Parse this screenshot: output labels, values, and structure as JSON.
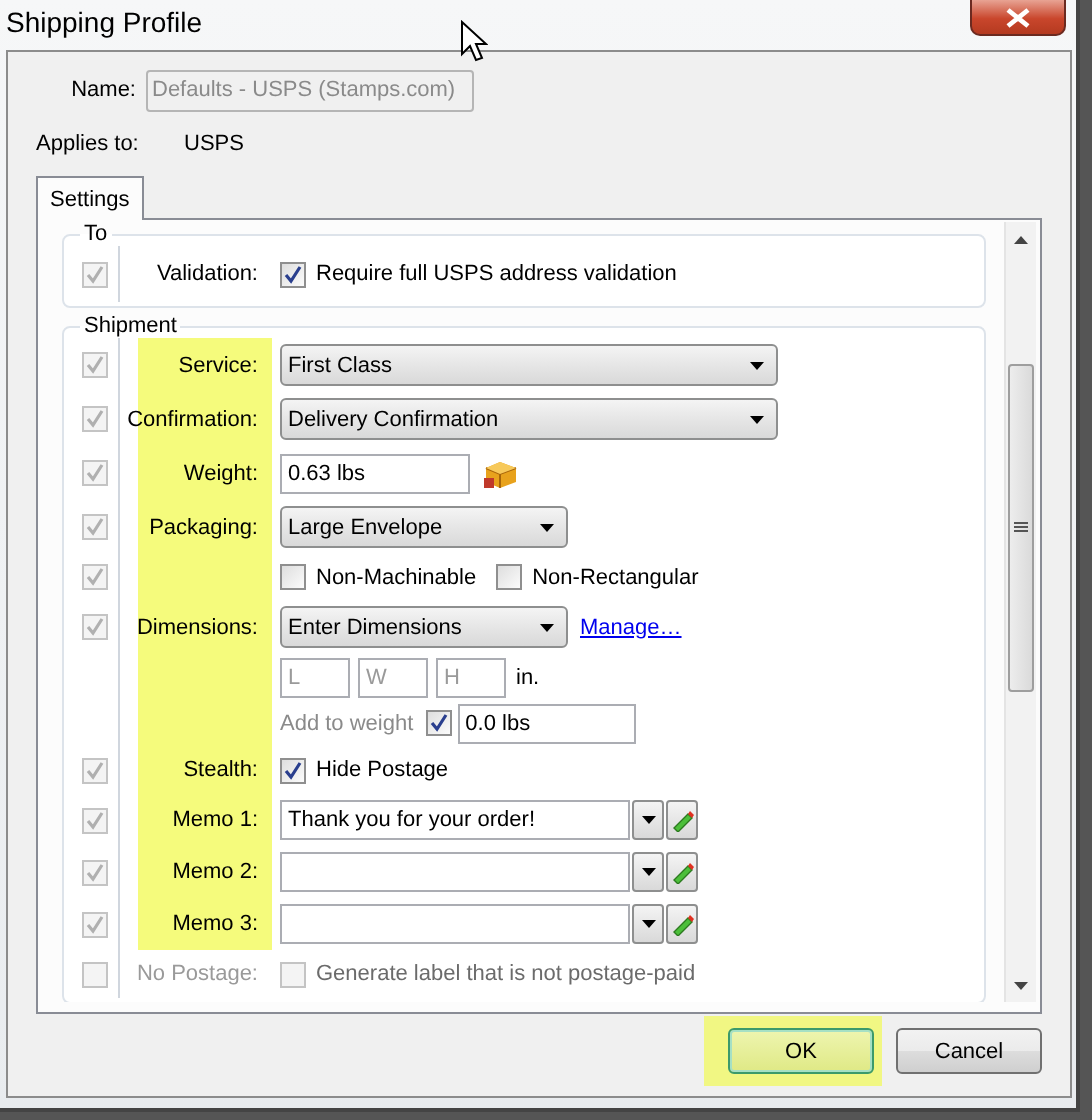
{
  "window": {
    "title": "Shipping Profile"
  },
  "name": {
    "label": "Name:",
    "value": "Defaults - USPS (Stamps.com)",
    "disabled": true
  },
  "applies_to": {
    "label": "Applies to:",
    "value": "USPS"
  },
  "tabs": [
    {
      "label": "Settings",
      "selected": true
    }
  ],
  "groups": [
    {
      "title": "To",
      "rows": [
        {
          "kind": "checkbox",
          "toggle": true,
          "highlighted": false,
          "disabled": false,
          "label": "Validation:",
          "option": {
            "label": "Require full USPS address validation",
            "checked": true
          }
        }
      ]
    },
    {
      "title": "Shipment",
      "rows": [
        {
          "kind": "dropdown",
          "toggle": true,
          "highlighted": true,
          "label": "Service:",
          "value": "First Class"
        },
        {
          "kind": "dropdown",
          "toggle": true,
          "highlighted": true,
          "label": "Confirmation:",
          "value": "Delivery Confirmation"
        },
        {
          "kind": "weight",
          "toggle": true,
          "highlighted": true,
          "label": "Weight:",
          "value": "0.63 lbs"
        },
        {
          "kind": "small_dropdown",
          "toggle": true,
          "highlighted": true,
          "label": "Packaging:",
          "value": "Large Envelope"
        },
        {
          "kind": "checkboxes",
          "toggle": true,
          "highlighted": true,
          "options": [
            {
              "label": "Non-Machinable",
              "checked": false
            },
            {
              "label": "Non-Rectangular",
              "checked": false
            }
          ]
        },
        {
          "kind": "small_dropdown",
          "toggle": true,
          "highlighted": true,
          "label": "Dimensions:",
          "value": "Enter Dimensions",
          "link": "Manage…"
        },
        {
          "kind": "dimensions",
          "highlighted": true,
          "placeholders": [
            "L",
            "W",
            "H"
          ],
          "unit": "in."
        },
        {
          "kind": "add_weight",
          "highlighted": true,
          "text": "Add to weight",
          "checked": true,
          "value": "0.0 lbs"
        },
        {
          "kind": "checkbox",
          "toggle": true,
          "highlighted": true,
          "disabled": false,
          "label": "Stealth:",
          "option": {
            "label": "Hide Postage",
            "checked": true
          }
        },
        {
          "kind": "memo",
          "toggle": true,
          "highlighted": true,
          "label": "Memo 1:",
          "value": "Thank you for your order!"
        },
        {
          "kind": "memo",
          "toggle": true,
          "highlighted": true,
          "label": "Memo 2:"
        },
        {
          "kind": "memo",
          "toggle": true,
          "highlighted": true,
          "label": "Memo 3:"
        },
        {
          "kind": "checkbox",
          "toggle": false,
          "highlighted": false,
          "disabled": true,
          "label": "No Postage:",
          "option": {
            "label": "Generate label that is not postage-paid",
            "checked": false
          }
        }
      ]
    }
  ],
  "buttons": [
    {
      "label": "OK",
      "highlighted": true,
      "default": true
    },
    {
      "label": "Cancel",
      "highlighted": false,
      "default": false
    }
  ]
}
